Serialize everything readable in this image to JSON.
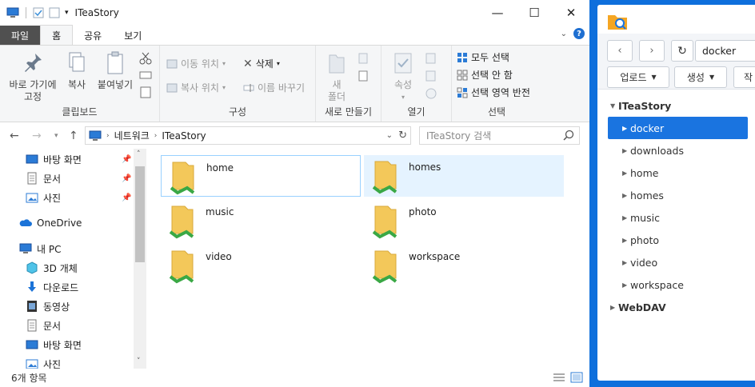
{
  "explorer": {
    "title": "ITeaStory",
    "tabs": [
      "파일",
      "홈",
      "공유",
      "보기"
    ],
    "active_tab": "홈",
    "ribbon": {
      "clipboard": {
        "label": "클립보드",
        "pin_line1": "바로 가기에",
        "pin_line2": "고정",
        "copy": "복사",
        "paste": "붙여넣기"
      },
      "organize": {
        "label": "구성",
        "move_to": "이동 위치",
        "copy_to": "복사 위치",
        "delete": "삭제",
        "rename": "이름 바꾸기"
      },
      "new": {
        "label": "새로 만들기",
        "folder_line1": "새",
        "folder_line2": "폴더"
      },
      "open": {
        "label": "열기",
        "properties": "속성"
      },
      "select": {
        "label": "선택",
        "select_all": "모두 선택",
        "select_none": "선택 안 함",
        "invert": "선택 영역 반전"
      }
    },
    "address": {
      "root": "네트워크",
      "current": "ITeaStory"
    },
    "search_placeholder": "ITeaStory 검색",
    "nav": {
      "quick": [
        {
          "label": "바탕 화면",
          "icon": "desktop-icon",
          "pinned": true
        },
        {
          "label": "문서",
          "icon": "document-icon",
          "pinned": true
        },
        {
          "label": "사진",
          "icon": "pictures-icon",
          "pinned": true
        }
      ],
      "onedrive": "OneDrive",
      "pc": "내 PC",
      "pc_items": [
        {
          "label": "3D 개체",
          "icon": "3d-objects-icon"
        },
        {
          "label": "다운로드",
          "icon": "download-icon"
        },
        {
          "label": "동영상",
          "icon": "video-icon"
        },
        {
          "label": "문서",
          "icon": "document-icon"
        },
        {
          "label": "바탕 화면",
          "icon": "desktop-icon"
        },
        {
          "label": "사진",
          "icon": "pictures-icon"
        }
      ]
    },
    "folders": [
      "home",
      "homes",
      "music",
      "photo",
      "video",
      "workspace"
    ],
    "status": "6개 항목"
  },
  "dsm": {
    "path_value": "docker",
    "upload": "업로드",
    "create": "생성",
    "action_partial": "작",
    "tree_root": "ITeaStory",
    "tree_items": [
      "docker",
      "downloads",
      "home",
      "homes",
      "music",
      "photo",
      "video",
      "workspace"
    ],
    "selected": "docker",
    "webdav": "WebDAV"
  },
  "colors": {
    "accent": "#0e6fdc",
    "selected": "#1a74e0",
    "folder": "#f3c85a",
    "share_green": "#3aa845"
  }
}
